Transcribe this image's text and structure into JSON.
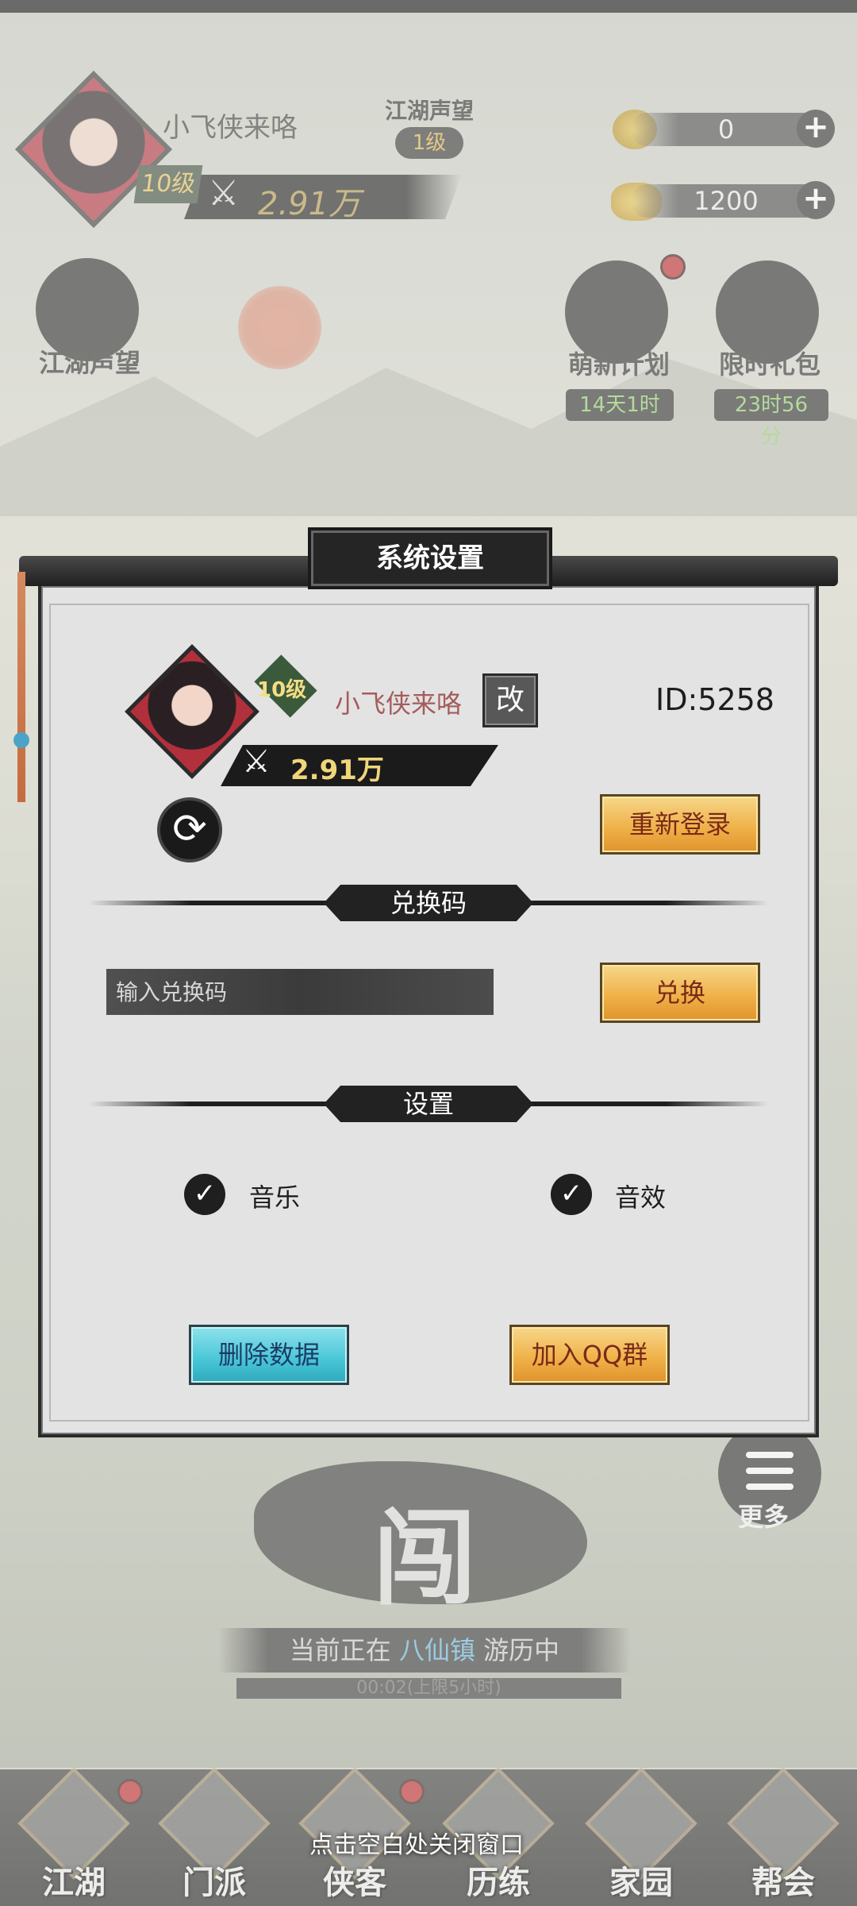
{
  "hud": {
    "player_name": "小飞侠来咯",
    "level": "10级",
    "power": "2.91万",
    "reputation_label": "江湖声望",
    "reputation_level": "1级",
    "currency_1": "0",
    "currency_2": "1200",
    "plus": "+"
  },
  "features": {
    "reputation": "江湖声望",
    "newbie_plan": "萌新计划",
    "newbie_timer": "14天1时",
    "limited_gift": "限时礼包",
    "gift_timer": "23时56分"
  },
  "modal": {
    "title": "系统设置",
    "player_name": "小飞侠来咯",
    "level": "10级",
    "rename": "改",
    "player_id": "ID:5258",
    "power": "2.91万",
    "relogin": "重新登录",
    "redeem_section": "兑换码",
    "code_placeholder": "输入兑换码",
    "redeem": "兑换",
    "settings_section": "设置",
    "music": "音乐",
    "sound_effects": "音效",
    "music_on": true,
    "sound_on": true,
    "delete_data": "删除数据",
    "join_qq": "加入QQ群"
  },
  "adventure": {
    "emblem": "闯",
    "status_prefix": "当前正在",
    "town": "八仙镇",
    "status_suffix": "游历中",
    "timer": "00:02(上限5小时)",
    "more": "更多"
  },
  "nav": {
    "items": [
      "江湖",
      "门派",
      "侠客",
      "历练",
      "家园",
      "帮会"
    ],
    "close_hint": "点击空白处关闭窗口"
  },
  "colors": {
    "accent_gold": "#f0b24a",
    "accent_cyan": "#47c6d7",
    "name_red": "#a55c5c",
    "timer_green": "#8fd06a"
  }
}
